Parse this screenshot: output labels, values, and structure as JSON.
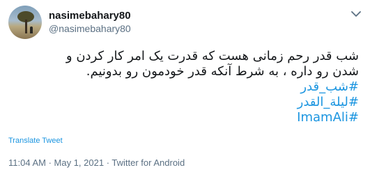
{
  "tweet": {
    "display_name": "nasimebahary80",
    "handle": "@nasimebahary80",
    "text_line_1": "شب قدر رحم زمانی هست که قدرت یک امر کار کردن و",
    "text_line_2": "شدن رو داره ، به شرط آنکه قدر خودمون رو بدونیم.",
    "hashtags": [
      "#شب_قدر",
      "#ليلة_القدر",
      "#ImamAli"
    ],
    "translate_label": "Translate Tweet",
    "time": "11:04 AM",
    "separator_1": " · ",
    "date": "May 1, 2021",
    "separator_2": " · ",
    "source": "Twitter for Android"
  },
  "icons": {
    "caret": "chevron-down-icon"
  },
  "colors": {
    "link": "#1b95e0",
    "secondary_text": "#5b7083",
    "primary_text": "#14171a"
  }
}
